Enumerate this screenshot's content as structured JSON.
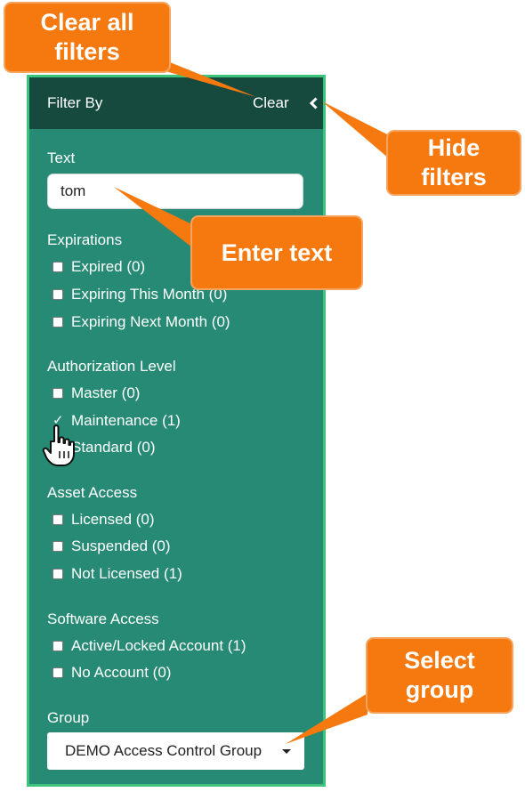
{
  "panel": {
    "header": {
      "title": "Filter By",
      "clear_label": "Clear",
      "collapse_icon": "chevron-left-icon"
    },
    "text_filter": {
      "label": "Text",
      "value": "tom"
    },
    "sections": [
      {
        "label": "Expirations",
        "options": [
          {
            "label": "Expired (0)",
            "checked": false
          },
          {
            "label": "Expiring This Month (0)",
            "checked": false
          },
          {
            "label": "Expiring Next Month (0)",
            "checked": false
          }
        ]
      },
      {
        "label": "Authorization Level",
        "options": [
          {
            "label": "Master (0)",
            "checked": false
          },
          {
            "label": "Maintenance (1)",
            "checked": true
          },
          {
            "label": "Standard (0)",
            "checked": false
          }
        ]
      },
      {
        "label": "Asset Access",
        "options": [
          {
            "label": "Licensed (0)",
            "checked": false
          },
          {
            "label": "Suspended (0)",
            "checked": false
          },
          {
            "label": "Not Licensed (1)",
            "checked": false
          }
        ]
      },
      {
        "label": "Software Access",
        "options": [
          {
            "label": "Active/Locked Account (1)",
            "checked": false
          },
          {
            "label": "No Account (0)",
            "checked": false
          }
        ]
      }
    ],
    "group": {
      "label": "Group",
      "selected": "DEMO Access Control Group"
    }
  },
  "callouts": {
    "clear_all": "Clear all filters",
    "hide_filters": "Hide filters",
    "enter_text": "Enter text",
    "select_group": "Select group"
  },
  "colors": {
    "panel_bg": "#268a74",
    "panel_border": "#3cc47a",
    "header_bg": "#164a3e",
    "callout_bg": "#f5790e"
  }
}
